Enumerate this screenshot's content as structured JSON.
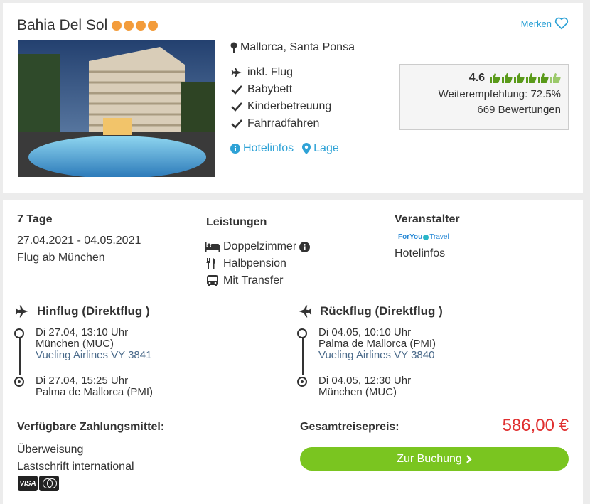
{
  "hotel": {
    "name": "Bahia Del Sol",
    "stars": 4,
    "location": "Mallorca, Santa Ponsa",
    "merken_label": "Merken",
    "features": [
      {
        "icon": "plane-icon",
        "label": "inkl. Flug"
      },
      {
        "icon": "check-icon",
        "label": "Babybett"
      },
      {
        "icon": "check-icon",
        "label": "Kinderbetreuung"
      },
      {
        "icon": "check-icon",
        "label": "Fahrradfahren"
      }
    ],
    "links": {
      "hotelinfos": "Hotelinfos",
      "lage": "Lage"
    }
  },
  "rating": {
    "score": "4.6",
    "thumbs": 6,
    "recommendation": "Weiterempfehlung: 72.5%",
    "reviews": "669 Bewertungen"
  },
  "trip": {
    "duration": "7 Tage",
    "dates": "27.04.2021 - 04.05.2021",
    "departure": "Flug ab München"
  },
  "services": {
    "title": "Leistungen",
    "items": [
      {
        "icon": "bed-icon",
        "label": "Doppelzimmer"
      },
      {
        "icon": "fork-knife-icon",
        "label": "Halbpension"
      },
      {
        "icon": "bus-icon",
        "label": "Mit Transfer"
      }
    ]
  },
  "operator": {
    "title": "Veranstalter",
    "logo_text_1": "ForYou",
    "logo_text_2": "Travel",
    "link": "Hotelinfos"
  },
  "outbound": {
    "title": "Hinflug (Direktflug )",
    "dep_time": "Di 27.04, 13:10 Uhr",
    "dep_airport": "München (MUC)",
    "airline": "Vueling Airlines VY 3841",
    "arr_time": "Di 27.04, 15:25 Uhr",
    "arr_airport": "Palma de Mallorca (PMI)"
  },
  "return": {
    "title": "Rückflug (Direktflug )",
    "dep_time": "Di 04.05, 10:10 Uhr",
    "dep_airport": "Palma de Mallorca (PMI)",
    "airline": "Vueling Airlines VY 3840",
    "arr_time": "Di 04.05, 12:30 Uhr",
    "arr_airport": "München (MUC)"
  },
  "payment": {
    "title": "Verfügbare Zahlungsmittel:",
    "methods": [
      "Überweisung",
      "Lastschrift international"
    ],
    "visa_label": "VISA"
  },
  "price": {
    "label": "Gesamtreisepreis:",
    "value": "586,00 €",
    "button": "Zur Buchung"
  },
  "colors": {
    "accent": "#2ea2d6",
    "price": "#e03030",
    "button": "#7ac520",
    "stars": "#f39c3b",
    "thumbs": "#5a9a1a"
  }
}
